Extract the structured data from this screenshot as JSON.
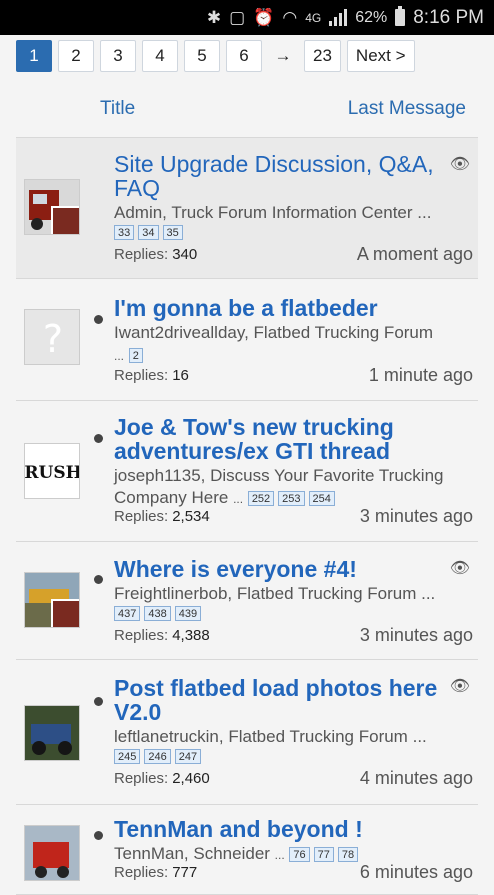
{
  "status_bar": {
    "battery": "62%",
    "time": "8:16 PM",
    "network": "4G"
  },
  "pagination": {
    "pages": [
      "1",
      "2",
      "3",
      "4",
      "5",
      "6"
    ],
    "arrow": "→",
    "last": "23",
    "next": "Next >"
  },
  "columns": {
    "title": "Title",
    "last_message": "Last Message"
  },
  "threads": [
    {
      "title": "Site Upgrade Discussion, Q&A, FAQ",
      "meta": "Admin, Truck Forum Information Center",
      "ellipsis": "...",
      "pages": [
        "33",
        "34",
        "35"
      ],
      "replies_label": "Replies:",
      "replies": "340",
      "ago": "A moment ago",
      "watched": true
    },
    {
      "title": "I'm gonna be a flatbeder",
      "meta": "Iwant2driveallday, Flatbed Trucking Forum",
      "ellipsis": "...",
      "pages": [
        "2"
      ],
      "replies_label": "Replies:",
      "replies": "16",
      "ago": "1 minute ago",
      "watched": false
    },
    {
      "title": "Joe & Tow's new trucking adventures/ex GTI thread",
      "meta": "joseph1135, Discuss Your Favorite Trucking Company Here",
      "ellipsis": "...",
      "pages": [
        "252",
        "253",
        "254"
      ],
      "replies_label": "Replies:",
      "replies": "2,534",
      "ago": "3 minutes ago",
      "watched": false
    },
    {
      "title": "Where is everyone #4!",
      "meta": "Freightlinerbob, Flatbed Trucking Forum",
      "ellipsis": "...",
      "pages": [
        "437",
        "438",
        "439"
      ],
      "replies_label": "Replies:",
      "replies": "4,388",
      "ago": "3 minutes ago",
      "watched": true
    },
    {
      "title": "Post flatbed load photos here V2.0",
      "meta": "leftlanetruckin, Flatbed Trucking Forum",
      "ellipsis": "...",
      "pages": [
        "245",
        "246",
        "247"
      ],
      "replies_label": "Replies:",
      "replies": "2,460",
      "ago": "4 minutes ago",
      "watched": true
    },
    {
      "title": "TennMan and beyond !",
      "meta": "TennMan, Schneider",
      "ellipsis": "...",
      "pages": [
        "76",
        "77",
        "78"
      ],
      "replies_label": "Replies:",
      "replies": "777",
      "ago": "6 minutes ago",
      "watched": false
    }
  ],
  "avatar_logo_text": "RUSH",
  "icons": {
    "watch": "eye-icon",
    "unread": "unread-dot-icon",
    "default_avatar": "question-avatar-icon"
  },
  "colors": {
    "link": "#2266bb",
    "accent": "#2b6cb0"
  }
}
